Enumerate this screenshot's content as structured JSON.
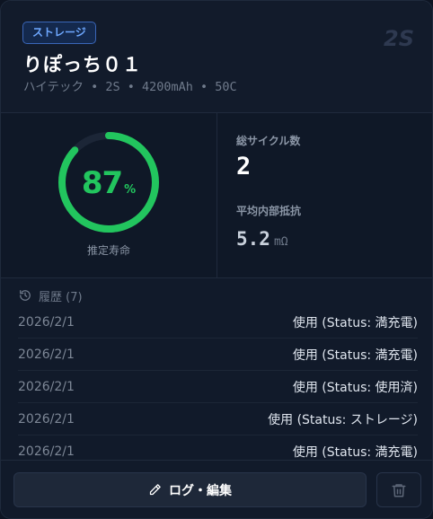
{
  "header": {
    "badge": "ストレージ",
    "title": "りぽっち０１",
    "spec": "ハイテック • 2S • 4200mAh • 50C",
    "cells": "2S"
  },
  "health": {
    "value": "87",
    "unit": "%",
    "fraction": 0.87,
    "label": "推定寿命",
    "color": "#22c55e"
  },
  "stats": {
    "cycles_label": "総サイクル数",
    "cycles_value": "2",
    "ir_label": "平均内部抵抗",
    "ir_value": "5.2",
    "ir_unit": "mΩ"
  },
  "history": {
    "title": "履歴 (7)",
    "rows": [
      {
        "date": "2026/2/1",
        "status": "使用 (Status: 満充電)"
      },
      {
        "date": "2026/2/1",
        "status": "使用 (Status: 満充電)"
      },
      {
        "date": "2026/2/1",
        "status": "使用 (Status: 使用済)"
      },
      {
        "date": "2026/2/1",
        "status": "使用 (Status: ストレージ)"
      },
      {
        "date": "2026/2/1",
        "status": "使用 (Status: 満充電)"
      }
    ]
  },
  "footer": {
    "edit_label": "ログ・編集"
  },
  "icons": {
    "history": "history-icon",
    "edit": "pencil-icon",
    "delete": "trash-icon"
  },
  "colors": {
    "accent": "#22c55e",
    "badge": "#6ea8ff",
    "background": "#111a2a"
  }
}
